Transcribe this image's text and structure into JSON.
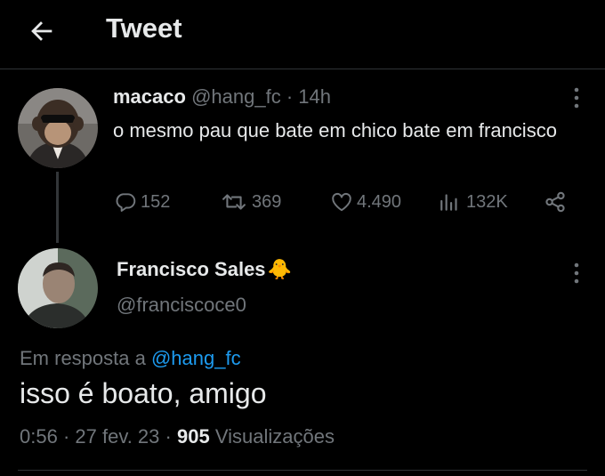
{
  "header": {
    "title": "Tweet",
    "back_icon": "arrow-left-icon"
  },
  "tweet1": {
    "name": "macaco",
    "handle": "@hang_fc",
    "separator": "·",
    "time": "14h",
    "text": "o mesmo pau que bate em chico bate em francisco",
    "replies": "152",
    "retweets": "369",
    "likes": "4.490",
    "views": "132K"
  },
  "tweet2": {
    "name": "Francisco Sales",
    "emoji": "🐥",
    "handle": "@franciscoce0",
    "reply_prefix": "Em resposta a ",
    "reply_to": "@hang_fc",
    "text": "isso é boato, amigo",
    "time": "0:56",
    "sep1": "·",
    "date": "27 fev. 23",
    "sep2": "·",
    "views_count": "905",
    "views_label": "Visualizações"
  },
  "colors": {
    "background": "#000000",
    "text": "#e7e9ea",
    "muted": "#71767b",
    "link": "#1d9bf0",
    "border": "#2f3336"
  }
}
